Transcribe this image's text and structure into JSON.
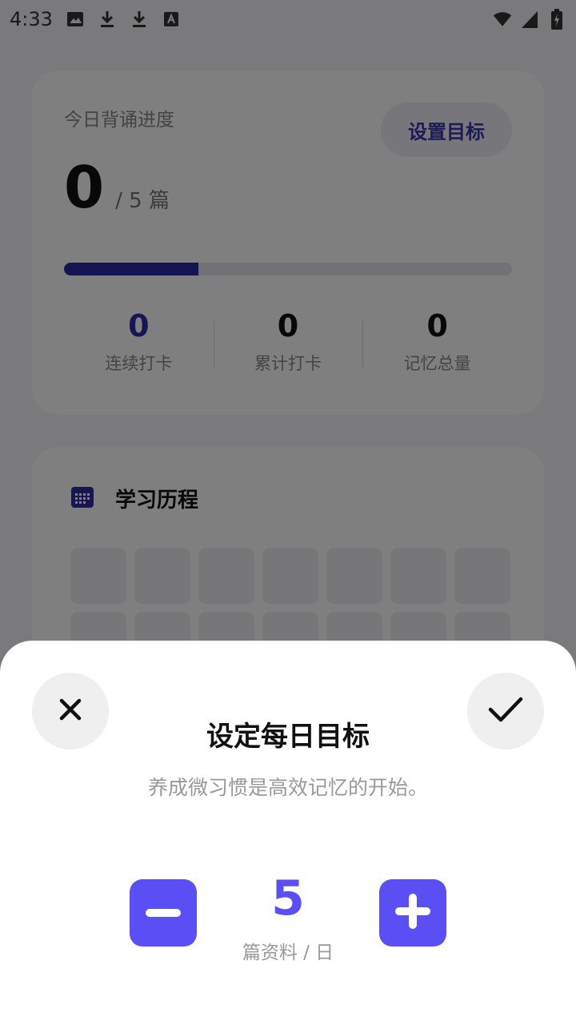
{
  "status_bar": {
    "time": "4:33",
    "left_icons": [
      "image-icon",
      "download-icon",
      "download-icon",
      "font-icon"
    ],
    "right_icons": [
      "wifi-icon",
      "signal-icon",
      "battery-charging-icon"
    ]
  },
  "progress_card": {
    "title": "今日背诵进度",
    "set_goal_label": "设置目标",
    "done_count": "0",
    "goal_text": "/ 5 篇",
    "progress_fraction": 0.3,
    "stats": [
      {
        "value": "0",
        "label": "连续打卡"
      },
      {
        "value": "0",
        "label": "累计打卡"
      },
      {
        "value": "0",
        "label": "记忆总量"
      }
    ]
  },
  "history_card": {
    "title": "学习历程",
    "icon": "calendar-icon"
  },
  "goal_sheet": {
    "title": "设定每日目标",
    "subtitle": "养成微习惯是高效记忆的开始。",
    "value": "5",
    "unit": "篇资料 / 日"
  },
  "colors": {
    "accent": "#5a4ff5",
    "accent_dark": "#2f2aa8"
  }
}
